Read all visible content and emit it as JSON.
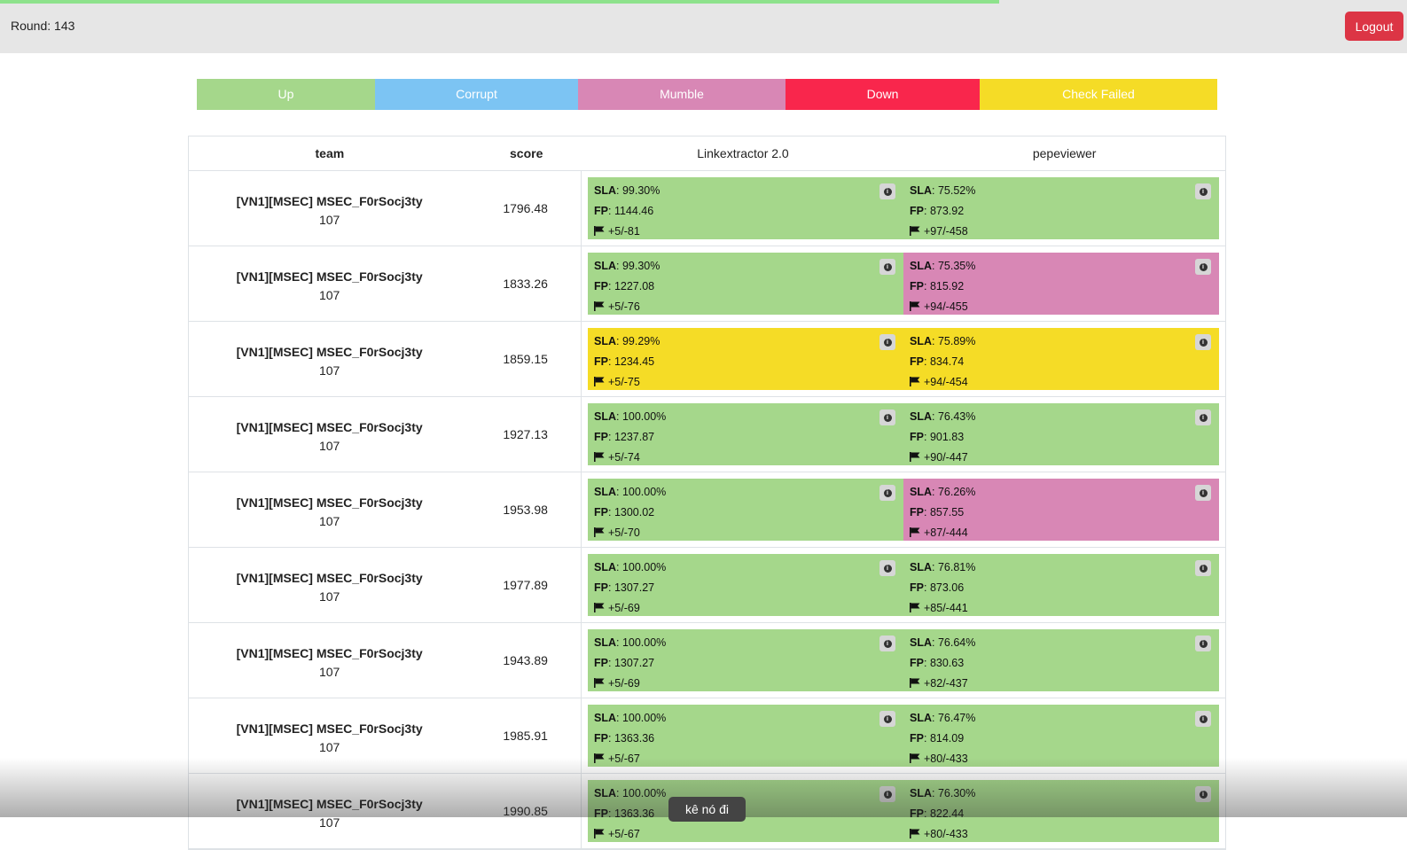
{
  "header": {
    "round_text": "Round: 143",
    "logout_label": "Logout",
    "progress_pct": 71
  },
  "legend": [
    {
      "label": "Up",
      "color": "#a5d78b"
    },
    {
      "label": "Corrupt",
      "color": "#7cc4f3"
    },
    {
      "label": "Mumble",
      "color": "#d887b5"
    },
    {
      "label": "Down",
      "color": "#f9264c"
    },
    {
      "label": "Check Failed",
      "color": "#f5dc26"
    }
  ],
  "table": {
    "headers": {
      "team": "team",
      "score": "score",
      "service1": "Linkextractor 2.0",
      "service2": "pepeviewer"
    },
    "rows": [
      {
        "team": "[VN1][MSEC] MSEC_F0rSocj3ty",
        "team_id": "107",
        "score": "1796.48",
        "s1": {
          "status": "up",
          "sla": "99.30%",
          "fp": "1144.46",
          "flags": "+5/-81"
        },
        "s2": {
          "status": "up",
          "sla": "75.52%",
          "fp": "873.92",
          "flags": "+97/-458"
        }
      },
      {
        "team": "[VN1][MSEC] MSEC_F0rSocj3ty",
        "team_id": "107",
        "score": "1833.26",
        "s1": {
          "status": "up",
          "sla": "99.30%",
          "fp": "1227.08",
          "flags": "+5/-76"
        },
        "s2": {
          "status": "mumble",
          "sla": "75.35%",
          "fp": "815.92",
          "flags": "+94/-455"
        }
      },
      {
        "team": "[VN1][MSEC] MSEC_F0rSocj3ty",
        "team_id": "107",
        "score": "1859.15",
        "s1": {
          "status": "check",
          "sla": "99.29%",
          "fp": "1234.45",
          "flags": "+5/-75"
        },
        "s2": {
          "status": "check",
          "sla": "75.89%",
          "fp": "834.74",
          "flags": "+94/-454"
        }
      },
      {
        "team": "[VN1][MSEC] MSEC_F0rSocj3ty",
        "team_id": "107",
        "score": "1927.13",
        "s1": {
          "status": "up",
          "sla": "100.00%",
          "fp": "1237.87",
          "flags": "+5/-74"
        },
        "s2": {
          "status": "up",
          "sla": "76.43%",
          "fp": "901.83",
          "flags": "+90/-447"
        }
      },
      {
        "team": "[VN1][MSEC] MSEC_F0rSocj3ty",
        "team_id": "107",
        "score": "1953.98",
        "s1": {
          "status": "up",
          "sla": "100.00%",
          "fp": "1300.02",
          "flags": "+5/-70"
        },
        "s2": {
          "status": "mumble",
          "sla": "76.26%",
          "fp": "857.55",
          "flags": "+87/-444"
        }
      },
      {
        "team": "[VN1][MSEC] MSEC_F0rSocj3ty",
        "team_id": "107",
        "score": "1977.89",
        "s1": {
          "status": "up",
          "sla": "100.00%",
          "fp": "1307.27",
          "flags": "+5/-69"
        },
        "s2": {
          "status": "up",
          "sla": "76.81%",
          "fp": "873.06",
          "flags": "+85/-441"
        }
      },
      {
        "team": "[VN1][MSEC] MSEC_F0rSocj3ty",
        "team_id": "107",
        "score": "1943.89",
        "s1": {
          "status": "up",
          "sla": "100.00%",
          "fp": "1307.27",
          "flags": "+5/-69"
        },
        "s2": {
          "status": "up",
          "sla": "76.64%",
          "fp": "830.63",
          "flags": "+82/-437"
        }
      },
      {
        "team": "[VN1][MSEC] MSEC_F0rSocj3ty",
        "team_id": "107",
        "score": "1985.91",
        "s1": {
          "status": "up",
          "sla": "100.00%",
          "fp": "1363.36",
          "flags": "+5/-67"
        },
        "s2": {
          "status": "up",
          "sla": "76.47%",
          "fp": "814.09",
          "flags": "+80/-433"
        }
      },
      {
        "team": "[VN1][MSEC] MSEC_F0rSocj3ty",
        "team_id": "107",
        "score": "1990.85",
        "s1": {
          "status": "up",
          "sla": "100.00%",
          "fp": "1363.36",
          "flags": "+5/-67"
        },
        "s2": {
          "status": "up",
          "sla": "76.30%",
          "fp": "822.44",
          "flags": "+80/-433"
        }
      }
    ]
  },
  "tooltip": {
    "text": "kê nó đi"
  },
  "labels": {
    "sla": "SLA",
    "fp": "FP"
  }
}
